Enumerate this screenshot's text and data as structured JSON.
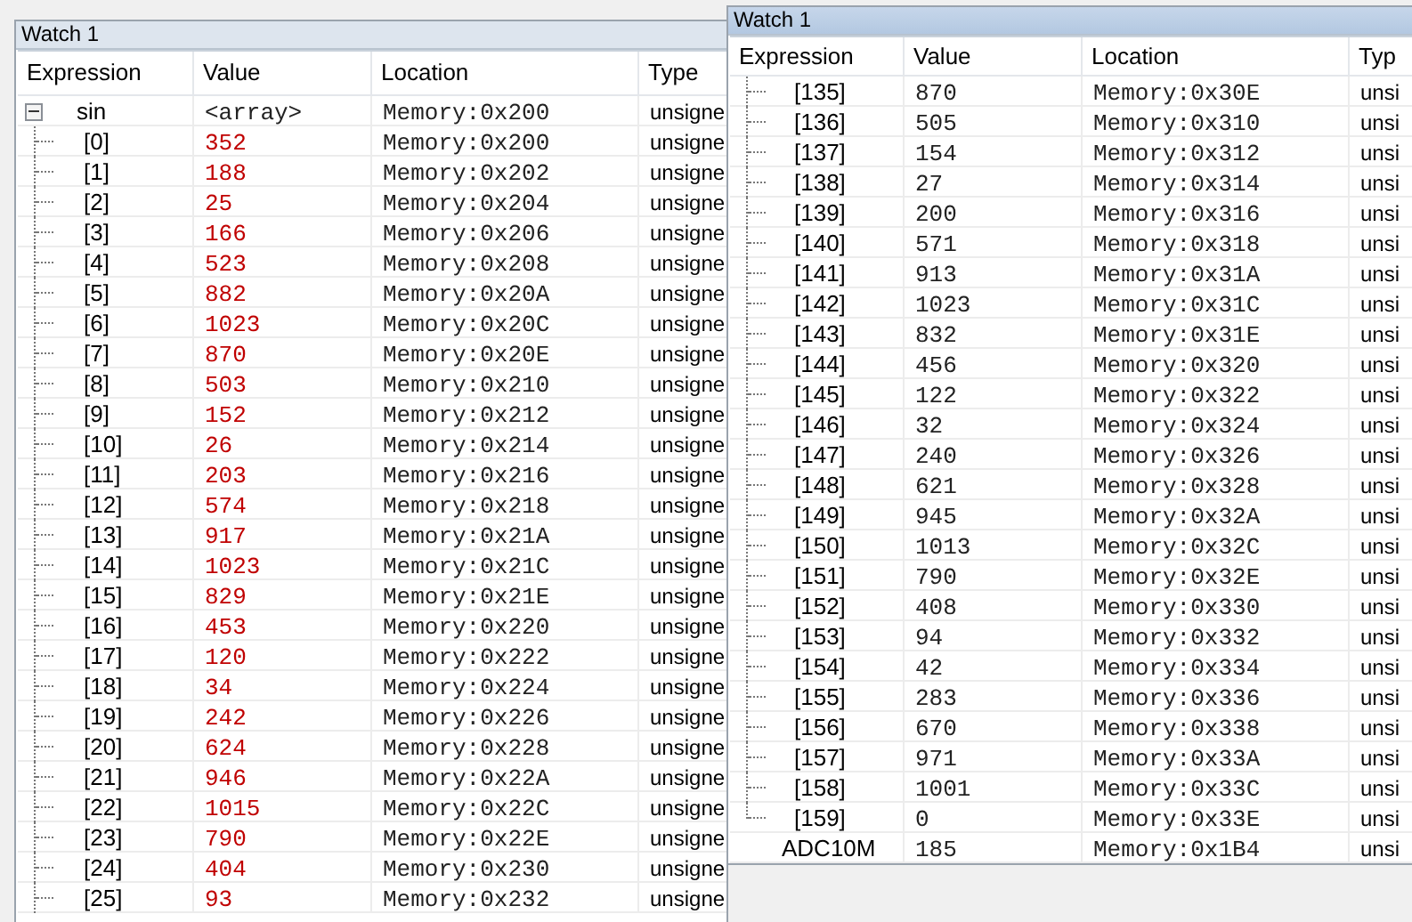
{
  "windows": [
    {
      "title": "Watch 1",
      "columns": [
        "Expression",
        "Value",
        "Location",
        "Type"
      ],
      "rows": [
        {
          "kind": "variable",
          "expression": "sin",
          "value": "<array>",
          "location": "Memory:0x200",
          "type": "unsigne",
          "changed": false,
          "expanded": true,
          "children": [
            {
              "kind": "element",
              "expression": "[0]",
              "value": "352",
              "location": "Memory:0x200",
              "type": "unsigne",
              "changed": true
            },
            {
              "kind": "element",
              "expression": "[1]",
              "value": "188",
              "location": "Memory:0x202",
              "type": "unsigne",
              "changed": true
            },
            {
              "kind": "element",
              "expression": "[2]",
              "value": "25",
              "location": "Memory:0x204",
              "type": "unsigne",
              "changed": true
            },
            {
              "kind": "element",
              "expression": "[3]",
              "value": "166",
              "location": "Memory:0x206",
              "type": "unsigne",
              "changed": true
            },
            {
              "kind": "element",
              "expression": "[4]",
              "value": "523",
              "location": "Memory:0x208",
              "type": "unsigne",
              "changed": true
            },
            {
              "kind": "element",
              "expression": "[5]",
              "value": "882",
              "location": "Memory:0x20A",
              "type": "unsigne",
              "changed": true
            },
            {
              "kind": "element",
              "expression": "[6]",
              "value": "1023",
              "location": "Memory:0x20C",
              "type": "unsigne",
              "changed": true
            },
            {
              "kind": "element",
              "expression": "[7]",
              "value": "870",
              "location": "Memory:0x20E",
              "type": "unsigne",
              "changed": true
            },
            {
              "kind": "element",
              "expression": "[8]",
              "value": "503",
              "location": "Memory:0x210",
              "type": "unsigne",
              "changed": true
            },
            {
              "kind": "element",
              "expression": "[9]",
              "value": "152",
              "location": "Memory:0x212",
              "type": "unsigne",
              "changed": true
            },
            {
              "kind": "element",
              "expression": "[10]",
              "value": "26",
              "location": "Memory:0x214",
              "type": "unsigne",
              "changed": true
            },
            {
              "kind": "element",
              "expression": "[11]",
              "value": "203",
              "location": "Memory:0x216",
              "type": "unsigne",
              "changed": true
            },
            {
              "kind": "element",
              "expression": "[12]",
              "value": "574",
              "location": "Memory:0x218",
              "type": "unsigne",
              "changed": true
            },
            {
              "kind": "element",
              "expression": "[13]",
              "value": "917",
              "location": "Memory:0x21A",
              "type": "unsigne",
              "changed": true
            },
            {
              "kind": "element",
              "expression": "[14]",
              "value": "1023",
              "location": "Memory:0x21C",
              "type": "unsigne",
              "changed": true
            },
            {
              "kind": "element",
              "expression": "[15]",
              "value": "829",
              "location": "Memory:0x21E",
              "type": "unsigne",
              "changed": true
            },
            {
              "kind": "element",
              "expression": "[16]",
              "value": "453",
              "location": "Memory:0x220",
              "type": "unsigne",
              "changed": true
            },
            {
              "kind": "element",
              "expression": "[17]",
              "value": "120",
              "location": "Memory:0x222",
              "type": "unsigne",
              "changed": true
            },
            {
              "kind": "element",
              "expression": "[18]",
              "value": "34",
              "location": "Memory:0x224",
              "type": "unsigne",
              "changed": true
            },
            {
              "kind": "element",
              "expression": "[19]",
              "value": "242",
              "location": "Memory:0x226",
              "type": "unsigne",
              "changed": true
            },
            {
              "kind": "element",
              "expression": "[20]",
              "value": "624",
              "location": "Memory:0x228",
              "type": "unsigne",
              "changed": true
            },
            {
              "kind": "element",
              "expression": "[21]",
              "value": "946",
              "location": "Memory:0x22A",
              "type": "unsigne",
              "changed": true
            },
            {
              "kind": "element",
              "expression": "[22]",
              "value": "1015",
              "location": "Memory:0x22C",
              "type": "unsigne",
              "changed": true
            },
            {
              "kind": "element",
              "expression": "[23]",
              "value": "790",
              "location": "Memory:0x22E",
              "type": "unsigne",
              "changed": true
            },
            {
              "kind": "element",
              "expression": "[24]",
              "value": "404",
              "location": "Memory:0x230",
              "type": "unsigne",
              "changed": true
            },
            {
              "kind": "element",
              "expression": "[25]",
              "value": "93",
              "location": "Memory:0x232",
              "type": "unsigne",
              "changed": true
            }
          ]
        }
      ]
    },
    {
      "title": "Watch 1",
      "columns": [
        "Expression",
        "Value",
        "Location",
        "Typ"
      ],
      "rows": [
        {
          "kind": "element",
          "expression": "[135]",
          "value": "870",
          "location": "Memory:0x30E",
          "type": "unsi",
          "changed": false
        },
        {
          "kind": "element",
          "expression": "[136]",
          "value": "505",
          "location": "Memory:0x310",
          "type": "unsi",
          "changed": false
        },
        {
          "kind": "element",
          "expression": "[137]",
          "value": "154",
          "location": "Memory:0x312",
          "type": "unsi",
          "changed": false
        },
        {
          "kind": "element",
          "expression": "[138]",
          "value": "27",
          "location": "Memory:0x314",
          "type": "unsi",
          "changed": false
        },
        {
          "kind": "element",
          "expression": "[139]",
          "value": "200",
          "location": "Memory:0x316",
          "type": "unsi",
          "changed": false
        },
        {
          "kind": "element",
          "expression": "[140]",
          "value": "571",
          "location": "Memory:0x318",
          "type": "unsi",
          "changed": false
        },
        {
          "kind": "element",
          "expression": "[141]",
          "value": "913",
          "location": "Memory:0x31A",
          "type": "unsi",
          "changed": false
        },
        {
          "kind": "element",
          "expression": "[142]",
          "value": "1023",
          "location": "Memory:0x31C",
          "type": "unsi",
          "changed": false
        },
        {
          "kind": "element",
          "expression": "[143]",
          "value": "832",
          "location": "Memory:0x31E",
          "type": "unsi",
          "changed": false
        },
        {
          "kind": "element",
          "expression": "[144]",
          "value": "456",
          "location": "Memory:0x320",
          "type": "unsi",
          "changed": false
        },
        {
          "kind": "element",
          "expression": "[145]",
          "value": "122",
          "location": "Memory:0x322",
          "type": "unsi",
          "changed": false
        },
        {
          "kind": "element",
          "expression": "[146]",
          "value": "32",
          "location": "Memory:0x324",
          "type": "unsi",
          "changed": false
        },
        {
          "kind": "element",
          "expression": "[147]",
          "value": "240",
          "location": "Memory:0x326",
          "type": "unsi",
          "changed": false
        },
        {
          "kind": "element",
          "expression": "[148]",
          "value": "621",
          "location": "Memory:0x328",
          "type": "unsi",
          "changed": false
        },
        {
          "kind": "element",
          "expression": "[149]",
          "value": "945",
          "location": "Memory:0x32A",
          "type": "unsi",
          "changed": false
        },
        {
          "kind": "element",
          "expression": "[150]",
          "value": "1013",
          "location": "Memory:0x32C",
          "type": "unsi",
          "changed": false
        },
        {
          "kind": "element",
          "expression": "[151]",
          "value": "790",
          "location": "Memory:0x32E",
          "type": "unsi",
          "changed": false
        },
        {
          "kind": "element",
          "expression": "[152]",
          "value": "408",
          "location": "Memory:0x330",
          "type": "unsi",
          "changed": false
        },
        {
          "kind": "element",
          "expression": "[153]",
          "value": "94",
          "location": "Memory:0x332",
          "type": "unsi",
          "changed": false
        },
        {
          "kind": "element",
          "expression": "[154]",
          "value": "42",
          "location": "Memory:0x334",
          "type": "unsi",
          "changed": false
        },
        {
          "kind": "element",
          "expression": "[155]",
          "value": "283",
          "location": "Memory:0x336",
          "type": "unsi",
          "changed": false
        },
        {
          "kind": "element",
          "expression": "[156]",
          "value": "670",
          "location": "Memory:0x338",
          "type": "unsi",
          "changed": false
        },
        {
          "kind": "element",
          "expression": "[157]",
          "value": "971",
          "location": "Memory:0x33A",
          "type": "unsi",
          "changed": false
        },
        {
          "kind": "element",
          "expression": "[158]",
          "value": "1001",
          "location": "Memory:0x33C",
          "type": "unsi",
          "changed": false
        },
        {
          "kind": "element",
          "expression": "[159]",
          "value": "0",
          "location": "Memory:0x33E",
          "type": "unsi",
          "changed": false
        },
        {
          "kind": "variable",
          "expression": "ADC10M",
          "value": "185",
          "location": "Memory:0x1B4",
          "type": "unsi",
          "changed": false
        }
      ]
    }
  ]
}
